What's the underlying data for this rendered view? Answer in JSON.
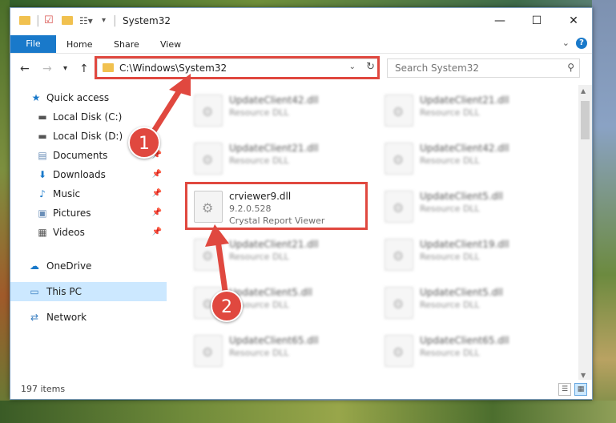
{
  "window": {
    "title": "System32",
    "minimize_glyph": "—",
    "maximize_glyph": "☐",
    "close_glyph": "✕"
  },
  "ribbon": {
    "file": "File",
    "home": "Home",
    "share": "Share",
    "view": "View",
    "help": "?"
  },
  "nav": {
    "back": "←",
    "forward": "→",
    "recent": "▾",
    "up": "↑"
  },
  "address": {
    "path": "C:\\Windows\\System32"
  },
  "search": {
    "placeholder": "Search System32"
  },
  "sidebar": {
    "items": [
      {
        "label": "Quick access",
        "icon": "star-icon"
      },
      {
        "label": "Local Disk (C:)",
        "icon": "drive-icon"
      },
      {
        "label": "Local Disk (D:)",
        "icon": "drive-icon"
      },
      {
        "label": "Documents",
        "icon": "document-icon"
      },
      {
        "label": "Downloads",
        "icon": "download-icon"
      },
      {
        "label": "Music",
        "icon": "music-icon"
      },
      {
        "label": "Pictures",
        "icon": "picture-icon"
      },
      {
        "label": "Videos",
        "icon": "video-icon"
      },
      {
        "label": "OneDrive",
        "icon": "cloud-icon"
      },
      {
        "label": "This PC",
        "icon": "computer-icon"
      },
      {
        "label": "Network",
        "icon": "network-icon"
      }
    ]
  },
  "files": {
    "left": [
      {
        "name": "UpdateClient42.dll",
        "desc": "Resource DLL"
      },
      {
        "name": "UpdateClient21.dll",
        "desc": "Resource DLL"
      },
      {
        "name": "crviewer9.dll",
        "version": "9.2.0.528",
        "desc": "Crystal Report Viewer"
      },
      {
        "name": "UpdateClient21.dll",
        "desc": "Resource DLL"
      },
      {
        "name": "UpdateClient5.dll",
        "desc": "Resource DLL"
      },
      {
        "name": "UpdateClient65.dll",
        "desc": "Resource DLL"
      }
    ],
    "right": [
      {
        "name": "UpdateClient21.dll",
        "desc": "Resource DLL"
      },
      {
        "name": "UpdateClient42.dll",
        "desc": "Resource DLL"
      },
      {
        "name": "UpdateClient5.dll",
        "desc": "Resource DLL"
      },
      {
        "name": "UpdateClient19.dll",
        "desc": "Resource DLL"
      },
      {
        "name": "UpdateClient5.dll",
        "desc": "Resource DLL"
      },
      {
        "name": "UpdateClient65.dll",
        "desc": "Resource DLL"
      }
    ]
  },
  "status": {
    "items_count": "197 items"
  },
  "annotations": {
    "step1": "1",
    "step2": "2",
    "highlight_color": "#e0483f"
  },
  "colors": {
    "accent": "#1979ca",
    "selected": "#cce8ff"
  }
}
